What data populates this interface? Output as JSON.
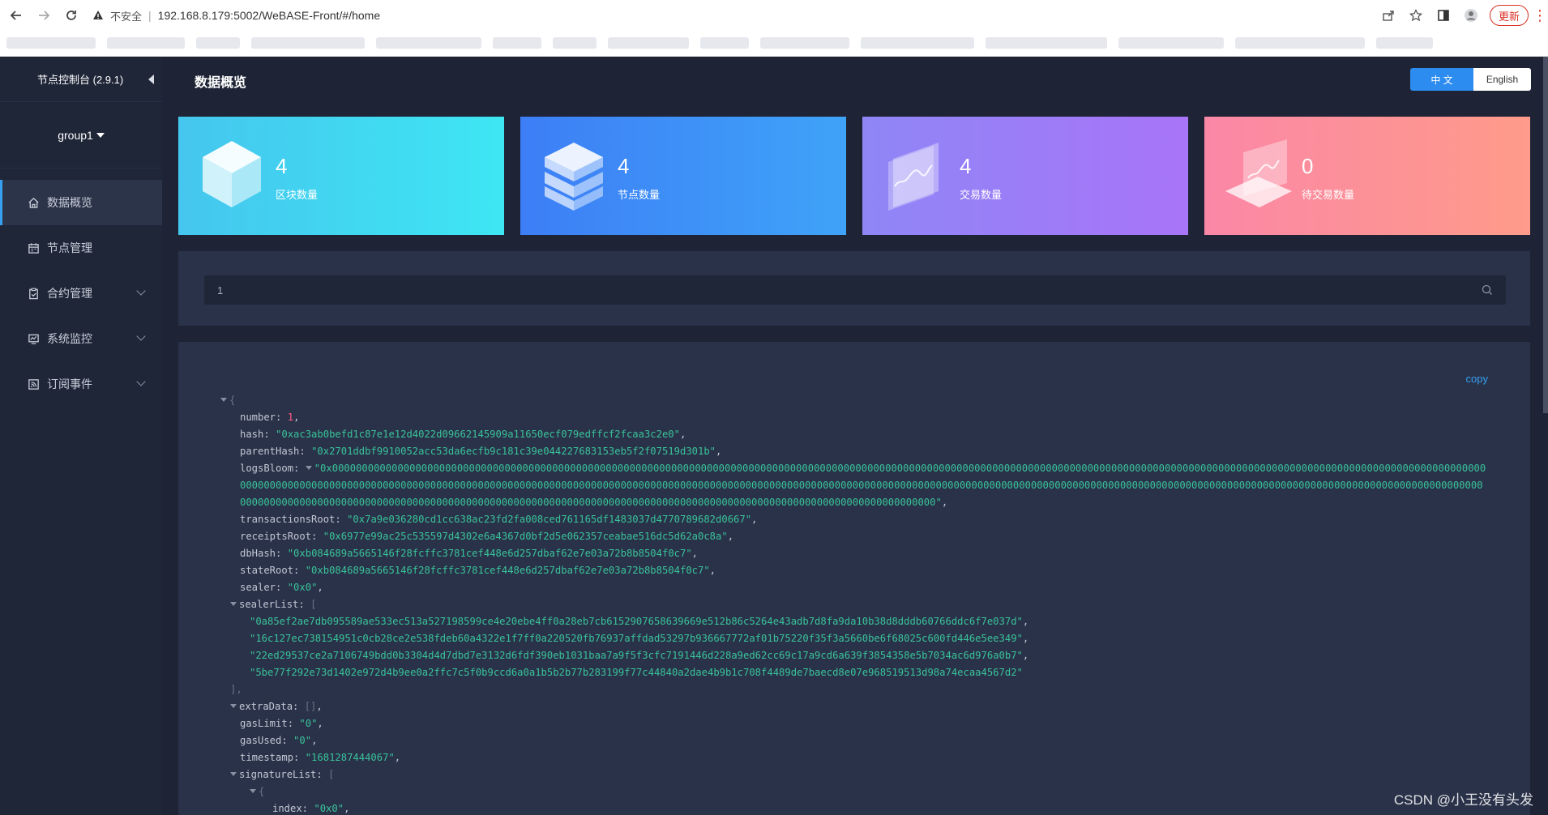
{
  "browser": {
    "security_label": "不安全",
    "separator": "|",
    "url": "192.168.8.179:5002/WeBASE-Front/#/home",
    "update_label": "更新"
  },
  "sidebar": {
    "title": "节点控制台 (2.9.1)",
    "group": "group1",
    "items": [
      {
        "label": "数据概览",
        "icon": "home-icon"
      },
      {
        "label": "节点管理",
        "icon": "calendar-icon"
      },
      {
        "label": "合约管理",
        "icon": "clipboard-icon"
      },
      {
        "label": "系统监控",
        "icon": "monitor-icon"
      },
      {
        "label": "订阅事件",
        "icon": "rss-icon"
      }
    ]
  },
  "header": {
    "title": "数据概览",
    "lang_zh": "中 文",
    "lang_en": "English"
  },
  "cards": [
    {
      "value": "4",
      "label": "区块数量",
      "color": "#3ee6f3"
    },
    {
      "value": "4",
      "label": "节点数量",
      "color": "#3d8cf6"
    },
    {
      "value": "4",
      "label": "交易数量",
      "color": "#a07cf8"
    },
    {
      "value": "0",
      "label": "待交易数量",
      "color": "#fd8f98"
    }
  ],
  "search": {
    "value": "1"
  },
  "json_view": {
    "copy_label": "copy",
    "number": "1",
    "hash": "\"0xac3ab0befd1c87e1e12d4022d09662145909a11650ecf079edffcf2fcaa3c2e0\"",
    "parentHash": "\"0x2701ddbf9910052acc53da6ecfb9c181c39e044227683153eb5f2f07519d301b\"",
    "logsBloom": "\"0x0000000000000000000000000000000000000000000000000000000000000000000000000000000000000000000000000000000000000000000000000000000000000000000000000000000000000000000000000000000000000000000000000000000000000000000000000000000000000000000000000000000000000000000000000000000000000000000000000000000000000000000000000000000000000000000000000000000000000000000000000000000000000000000000000000000000000000000000000000000000000000000000000000000000000000000000000000000000000000000000000000000000000000000000000000000000000000\"",
    "transactionsRoot": "\"0x7a9e036280cd1cc638ac23fd2fa008ced761165df1483037d4770789682d0667\"",
    "receiptsRoot": "\"0x6977e99ac25c535597d4302e6a4367d0bf2d5e062357ceabae516dc5d62a0c8a\"",
    "dbHash": "\"0xb084689a5665146f28fcffc3781cef448e6d257dbaf62e7e03a72b8b8504f0c7\"",
    "stateRoot": "\"0xb084689a5665146f28fcffc3781cef448e6d257dbaf62e7e03a72b8b8504f0c7\"",
    "sealer": "\"0x0\"",
    "sealerList": [
      "\"0a85ef2ae7db095589ae533ec513a527198599ce4e20ebe4ff0a28eb7cb6152907658639669e512b86c5264e43adb7d8fa9da10b38d8dddb60766ddc6f7e037d\"",
      "\"16c127ec738154951c0cb28ce2e538fdeb60a4322e1f7ff0a220520fb76937affdad53297b936667772af01b75220f35f3a5660be6f68025c600fd446e5ee349\"",
      "\"22ed29537ce2a7106749bdd0b3304d4d7dbd7e3132d6fdf390eb1031baa7a9f5f3cfc7191446d228a9ed62cc69c17a9cd6a639f3854358e5b7034ac6d976a0b7\"",
      "\"5be77f292e73d1402e972d4b9ee0a2ffc7c5f0b9ccd6a0a1b5b2b77b283199f77c44840a2dae4b9b1c708f4489de7baecd8e07e968519513d98a74ecaa4567d2\""
    ],
    "extraData": "[]",
    "gasLimit": "\"0\"",
    "gasUsed": "\"0\"",
    "timestamp": "\"1681287444067\"",
    "sig_index": "\"0x0\""
  },
  "watermark": "CSDN @小王没有头发"
}
